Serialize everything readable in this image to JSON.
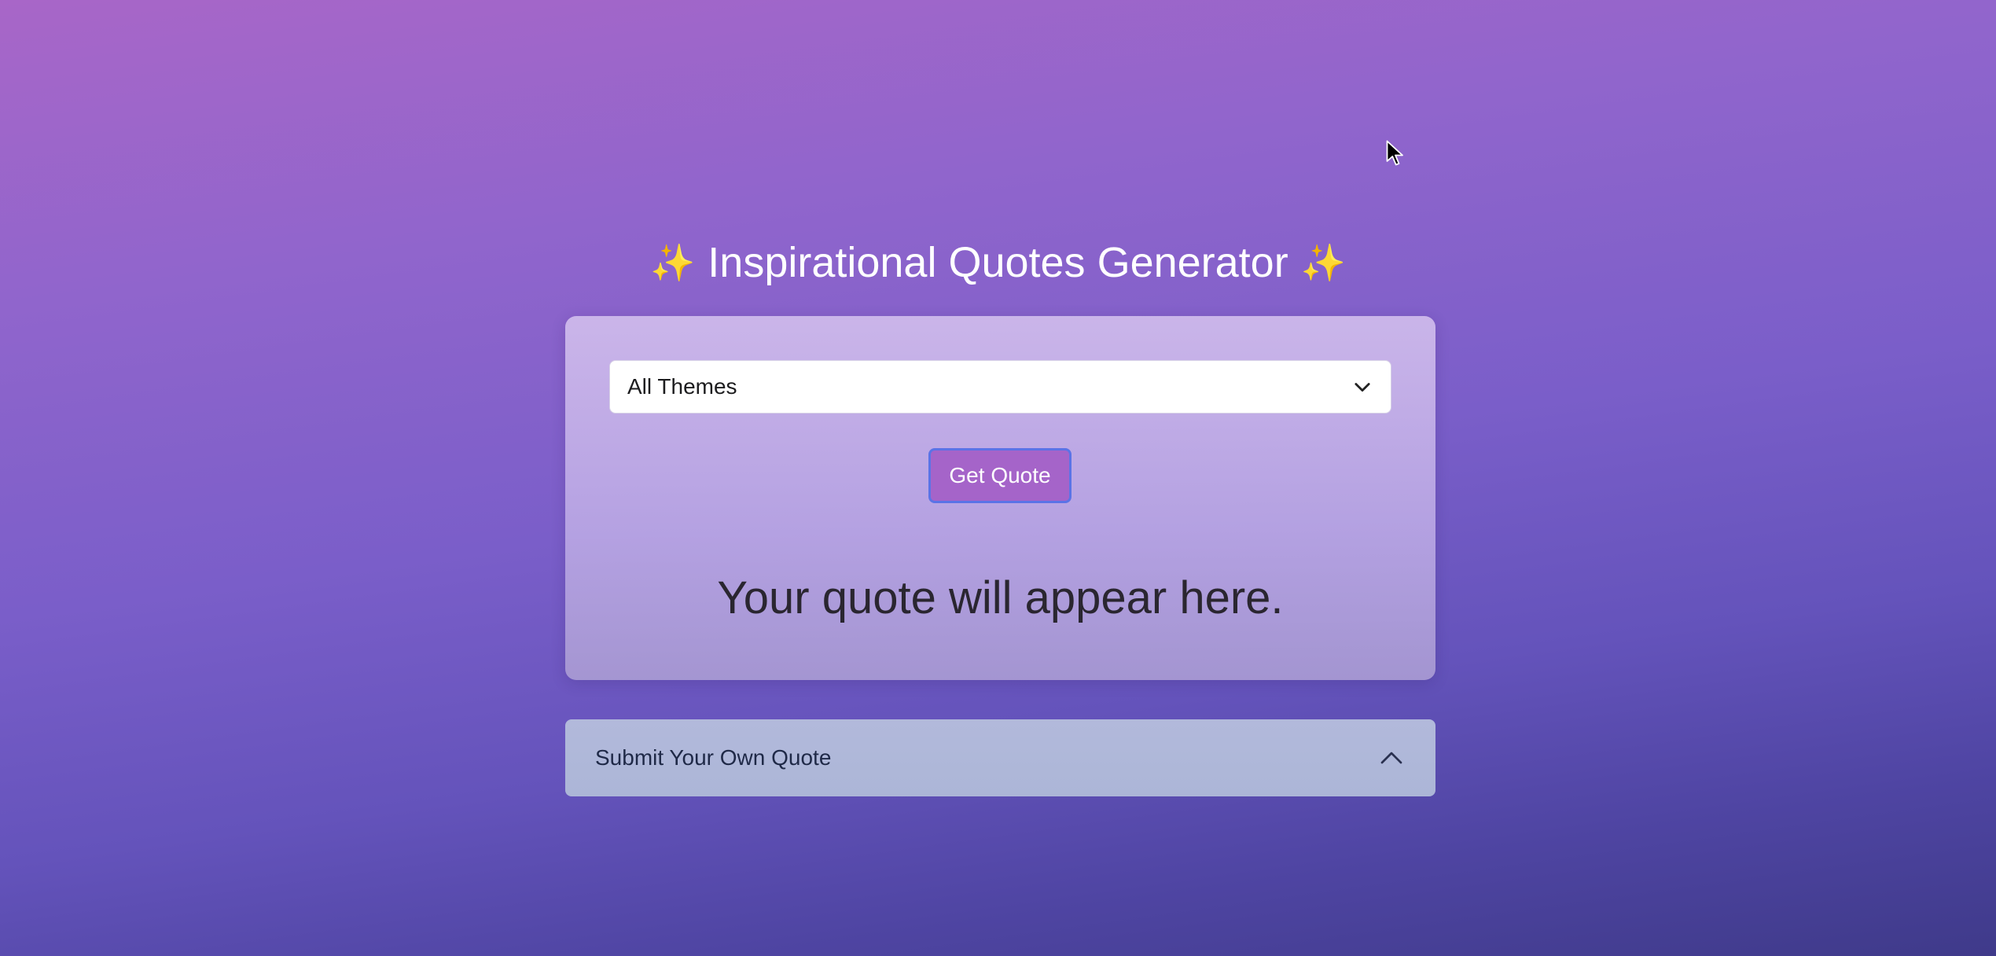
{
  "header": {
    "sparkle_left": "✨",
    "title": "Inspirational Quotes Generator",
    "sparkle_right": "✨"
  },
  "quote_card": {
    "theme_select": {
      "selected": "All Themes",
      "icon": "chevron-down-icon"
    },
    "get_quote_label": "Get Quote",
    "quote_text": "Your quote will appear here."
  },
  "submit_section": {
    "label": "Submit Your Own Quote",
    "icon": "chevron-up-icon"
  },
  "colors": {
    "button_bg": "#a564c9",
    "button_border": "#5b73e6",
    "sparkle": "#f5cf4a"
  }
}
